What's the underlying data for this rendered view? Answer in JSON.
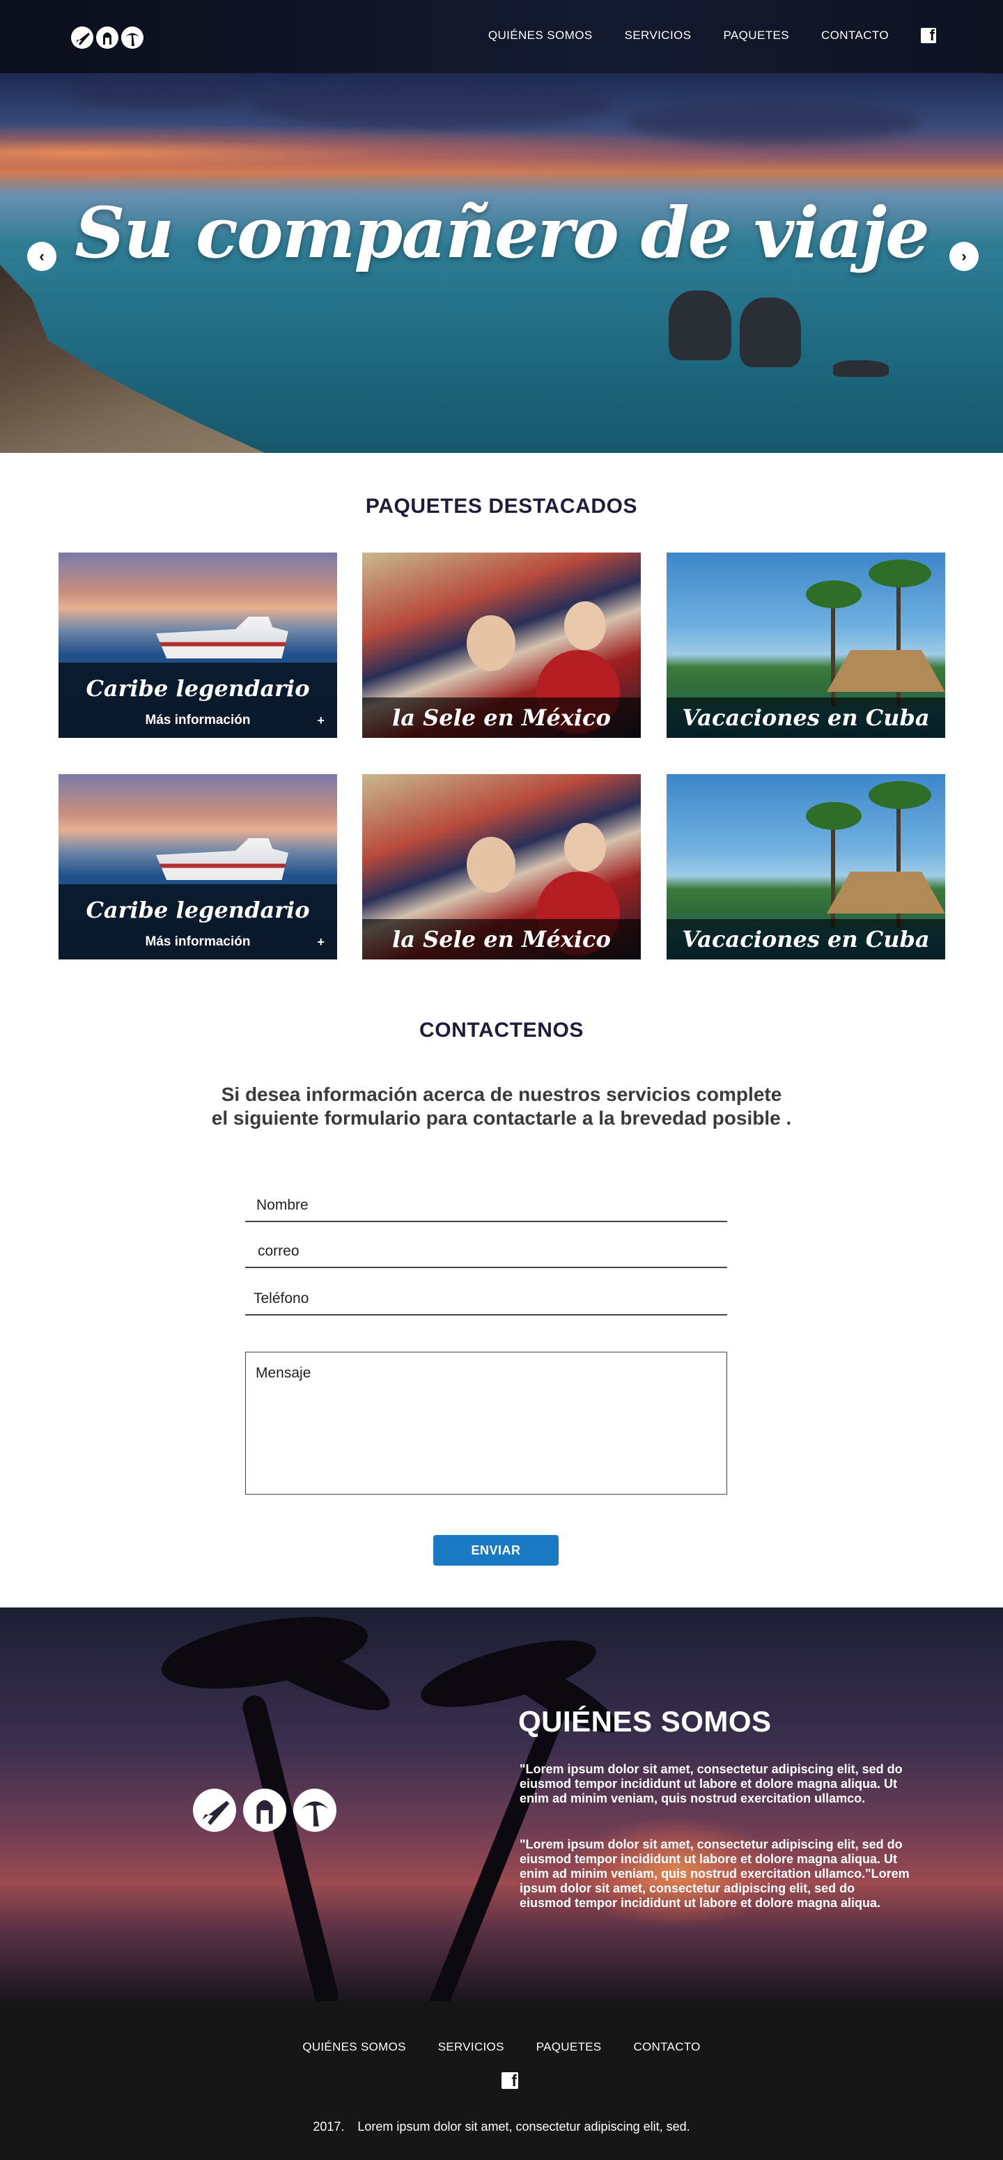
{
  "nav": {
    "logo_icons": [
      "plane-icon",
      "bell-icon",
      "palm-icon"
    ],
    "links": [
      "QUIÉNES SOMOS",
      "SERVICIOS",
      "PAQUETES",
      "CONTACTO"
    ],
    "social_icon": "facebook-icon"
  },
  "hero": {
    "title": "Su compañero de viaje",
    "prev_icon": "chevron-left-icon",
    "next_icon": "chevron-right-icon"
  },
  "packages": {
    "title": "PAQUETES DESTACADOS",
    "rows": [
      [
        {
          "title": "Caribe  legendario",
          "more": "Más información",
          "plus": "+"
        },
        {
          "title": "la Sele en México"
        },
        {
          "title": "Vacaciones en Cuba"
        }
      ],
      [
        {
          "title": "Caribe  legendario",
          "more": "Más información",
          "plus": "+"
        },
        {
          "title": "la Sele en México"
        },
        {
          "title": "Vacaciones en Cuba"
        }
      ]
    ]
  },
  "contact": {
    "title": "CONTACTENOS",
    "line1": "Si desea información acerca de nuestros servicios complete",
    "line2": "el siguiente formulario para contactarle a la brevedad posible .",
    "fields": [
      "Nombre",
      "correo",
      "Teléfono"
    ],
    "message": "Mensaje",
    "submit": "ENVIAR"
  },
  "about": {
    "title": "QUIÉNES SOMOS",
    "p1": "\"Lorem ipsum dolor sit amet, consectetur adipiscing elit, sed do eiusmod tempor incididunt ut labore et dolore magna aliqua. Ut enim ad minim veniam, quis nostrud exercitation ullamco.",
    "p2": "\"Lorem ipsum dolor sit amet, consectetur adipiscing elit, sed do eiusmod tempor incididunt ut labore et dolore magna aliqua. Ut enim ad minim veniam, quis nostrud exercitation ullamco.\"Lorem ipsum dolor sit amet, consectetur adipiscing elit, sed do eiusmod tempor incididunt ut labore et dolore magna aliqua."
  },
  "footer": {
    "links": [
      "QUIÉNES SOMOS",
      "SERVICIOS",
      "PAQUETES",
      "CONTACTO"
    ],
    "year": "2017.",
    "copy": "Lorem ipsum dolor sit amet, consectetur adipiscing elit, sed."
  }
}
